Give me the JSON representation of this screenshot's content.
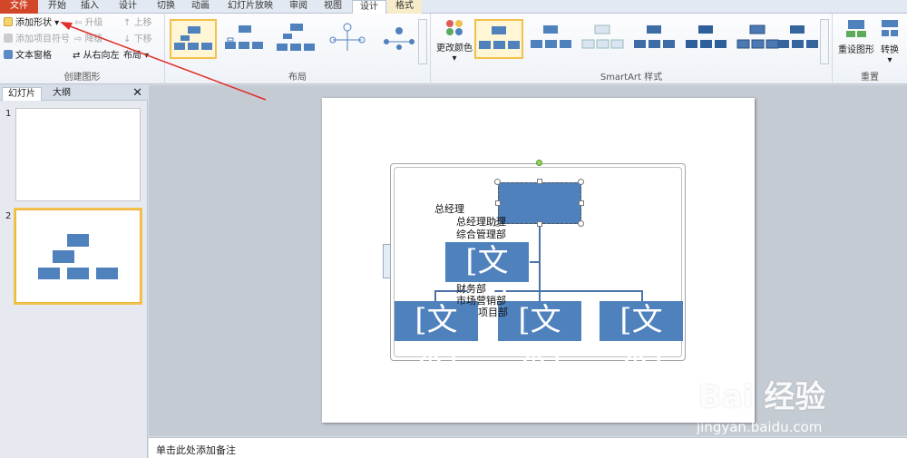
{
  "tabs": {
    "file": "文件",
    "home": "开始",
    "insert": "插入",
    "design": "设计",
    "transitions": "切换",
    "animations": "动画",
    "slideshow": "幻灯片放映",
    "review": "审阅",
    "view": "视图",
    "smartart_design": "设计",
    "format": "格式"
  },
  "ribbon": {
    "create_graphic": {
      "label": "创建图形",
      "add_shape": "添加形状",
      "add_bullet": "添加项目符号",
      "text_pane": "文本窗格",
      "promote": "升级",
      "demote": "降级",
      "right_to_left": "从右向左",
      "move_up": "上移",
      "move_down": "下移",
      "layout": "布局"
    },
    "layouts": {
      "label": "布局"
    },
    "styles": {
      "label": "SmartArt 样式",
      "change_colors": "更改颜色"
    },
    "reset": {
      "label": "重置",
      "reset_graphic": "重设图形",
      "convert": "转换"
    }
  },
  "slide_pane": {
    "tab_slides": "幻灯片",
    "tab_outline": "大纲",
    "close": "✕",
    "slide1_num": "1",
    "slide2_num": "2"
  },
  "smartart": {
    "text_lines": [
      "总经理",
      "总经理助理",
      "综合管理部",
      "财务部",
      "市场营销部",
      "项目部"
    ],
    "placeholder": "[文本]"
  },
  "notes": {
    "placeholder": "单击此处添加备注"
  },
  "watermark": {
    "brand": "Bai 经验",
    "url": "jingyan.baidu.com"
  },
  "colors": {
    "accent": "#4f81bd",
    "file_tab": "#d2472a",
    "selection": "#f2c14c",
    "arrow": "#e0302a"
  }
}
